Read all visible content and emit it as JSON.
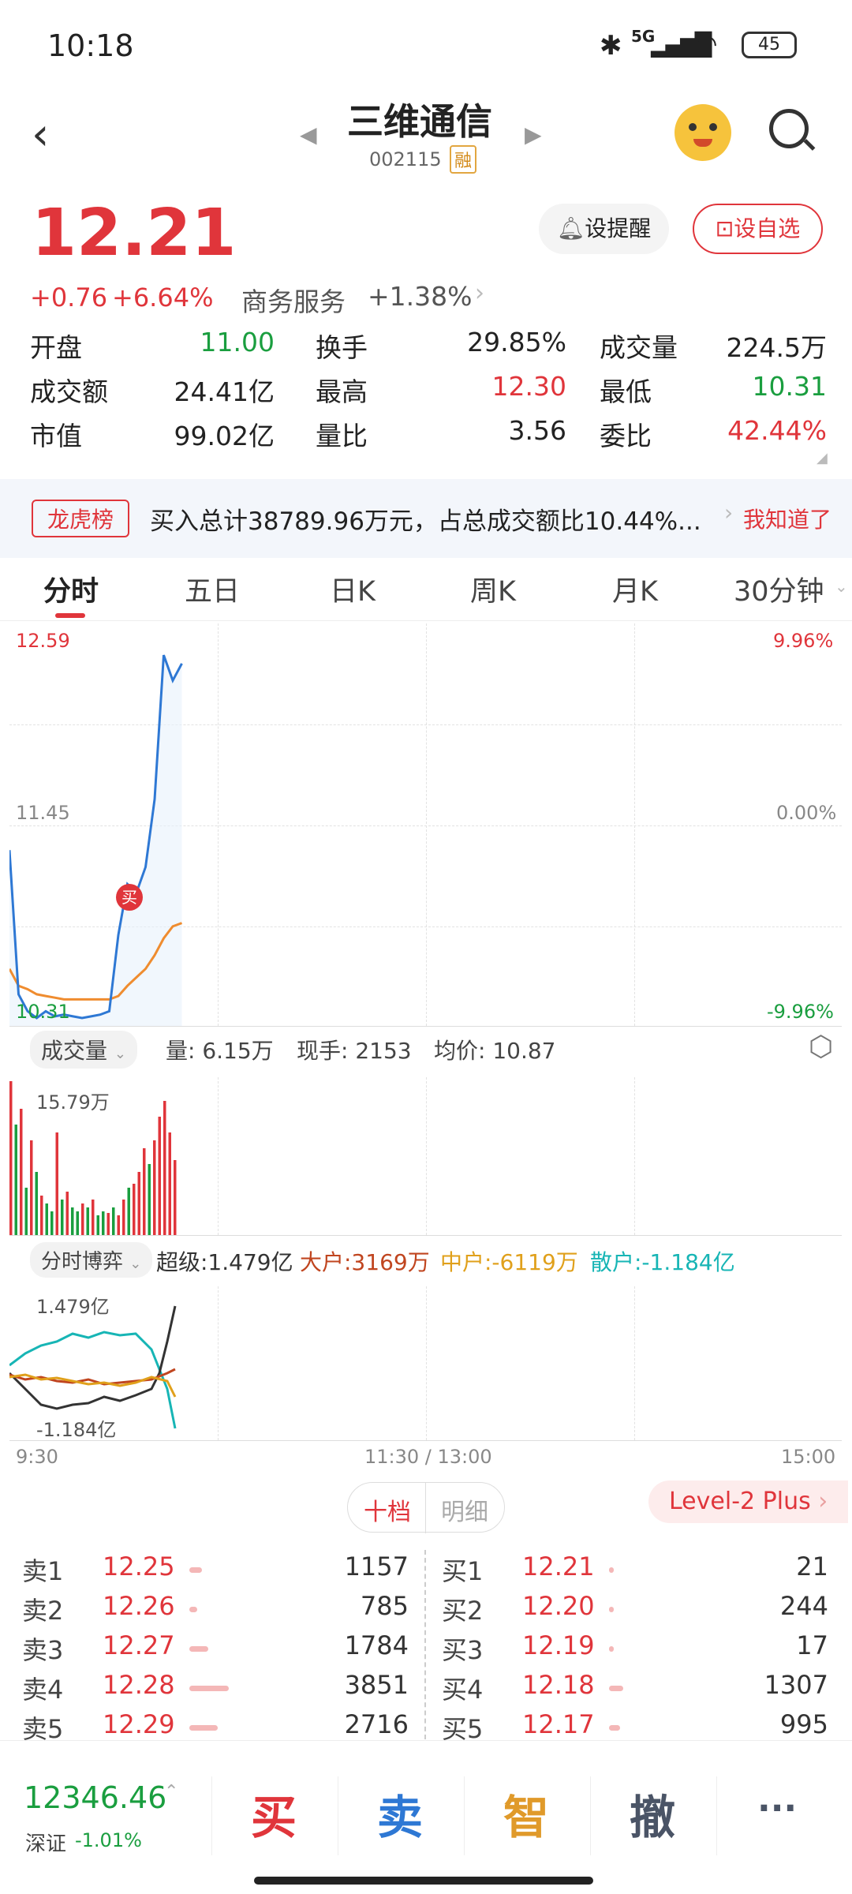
{
  "status_bar": {
    "time": "10:18",
    "signal": "5G",
    "battery": "45"
  },
  "header": {
    "title": "三维通信",
    "code": "002115",
    "tag": "融"
  },
  "quote": {
    "price": "12.21",
    "change": "+0.76",
    "change_pct": "+6.64%",
    "sector": "商务服务",
    "sector_change": "+1.38%",
    "alert_button": "设提醒",
    "watch_button": "设自选"
  },
  "stats": [
    [
      {
        "label": "开盘",
        "value": "11.00"
      },
      {
        "label": "换手",
        "value": "29.85%"
      },
      {
        "label": "成交量",
        "value": "224.5万"
      }
    ],
    [
      {
        "label": "成交额",
        "value": "24.41亿"
      },
      {
        "label": "最高",
        "value": "12.30"
      },
      {
        "label": "最低",
        "value": "10.31"
      }
    ],
    [
      {
        "label": "市值",
        "value": "99.02亿"
      },
      {
        "label": "量比",
        "value": "3.56"
      },
      {
        "label": "委比",
        "value": "42.44%"
      }
    ]
  ],
  "banner": {
    "tag": "龙虎榜",
    "text": "买入总计38789.96万元，占总成交额比10.44%...",
    "action": "我知道了"
  },
  "tabs": [
    "分时",
    "五日",
    "日K",
    "周K",
    "月K",
    "30分钟"
  ],
  "chart": {
    "price_high": "12.59",
    "price_mid": "11.45",
    "price_low": "10.31",
    "pct_high": "9.96%",
    "pct_mid": "0.00%",
    "pct_low": "-9.96%",
    "buy_marker": "买",
    "volume_selector": "成交量",
    "volume_info": "量: 6.15万",
    "current_hand": "现手: 2153",
    "avg_price": "均价: 10.87",
    "volume_max": "15.79万",
    "flow_selector": "分时博弈",
    "flow_super": "超级:1.479亿",
    "flow_large": "大户:3169万",
    "flow_medium": "中户:-6119万",
    "flow_retail": "散户:-1.184亿",
    "flow_max": "1.479亿",
    "flow_min": "-1.184亿",
    "time_start": "9:30",
    "time_mid": "11:30 / 13:00",
    "time_end": "15:00"
  },
  "chart_data": {
    "type": "line",
    "title": "",
    "ylim": [
      10.31,
      12.59
    ],
    "series": [
      {
        "name": "price",
        "values": [
          11.3,
          10.45,
          10.35,
          10.31,
          10.35,
          10.32,
          10.33,
          10.32,
          10.31,
          10.32,
          10.33,
          10.35,
          10.8,
          11.1,
          11.05,
          11.2,
          11.6,
          12.45,
          12.3,
          12.4
        ]
      },
      {
        "name": "avg",
        "values": [
          10.6,
          10.5,
          10.48,
          10.45,
          10.44,
          10.43,
          10.42,
          10.42,
          10.42,
          10.42,
          10.42,
          10.42,
          10.44,
          10.5,
          10.55,
          10.6,
          10.68,
          10.78,
          10.85,
          10.87
        ]
      }
    ]
  },
  "orderbook": {
    "tabs": [
      "十档",
      "明细"
    ],
    "level_badge": "Level-2 Plus",
    "sell": [
      {
        "label": "卖1",
        "price": "12.25",
        "vol": "1157",
        "bar": 0.08
      },
      {
        "label": "卖2",
        "price": "12.26",
        "vol": "785",
        "bar": 0.05
      },
      {
        "label": "卖3",
        "price": "12.27",
        "vol": "1784",
        "bar": 0.12
      },
      {
        "label": "卖4",
        "price": "12.28",
        "vol": "3851",
        "bar": 0.25
      },
      {
        "label": "卖5",
        "price": "12.29",
        "vol": "2716",
        "bar": 0.18
      }
    ],
    "buy": [
      {
        "label": "买1",
        "price": "12.21",
        "vol": "21",
        "bar": 0.01
      },
      {
        "label": "买2",
        "price": "12.20",
        "vol": "244",
        "bar": 0.02
      },
      {
        "label": "买3",
        "price": "12.19",
        "vol": "17",
        "bar": 0.01
      },
      {
        "label": "买4",
        "price": "12.18",
        "vol": "1307",
        "bar": 0.09
      },
      {
        "label": "买5",
        "price": "12.17",
        "vol": "995",
        "bar": 0.07
      }
    ]
  },
  "bottom": {
    "index_value": "12346.46",
    "index_name": "深证",
    "index_change": "-1.01%",
    "buy": "买",
    "sell": "卖",
    "smart": "智",
    "cancel": "撤",
    "more": "···"
  }
}
